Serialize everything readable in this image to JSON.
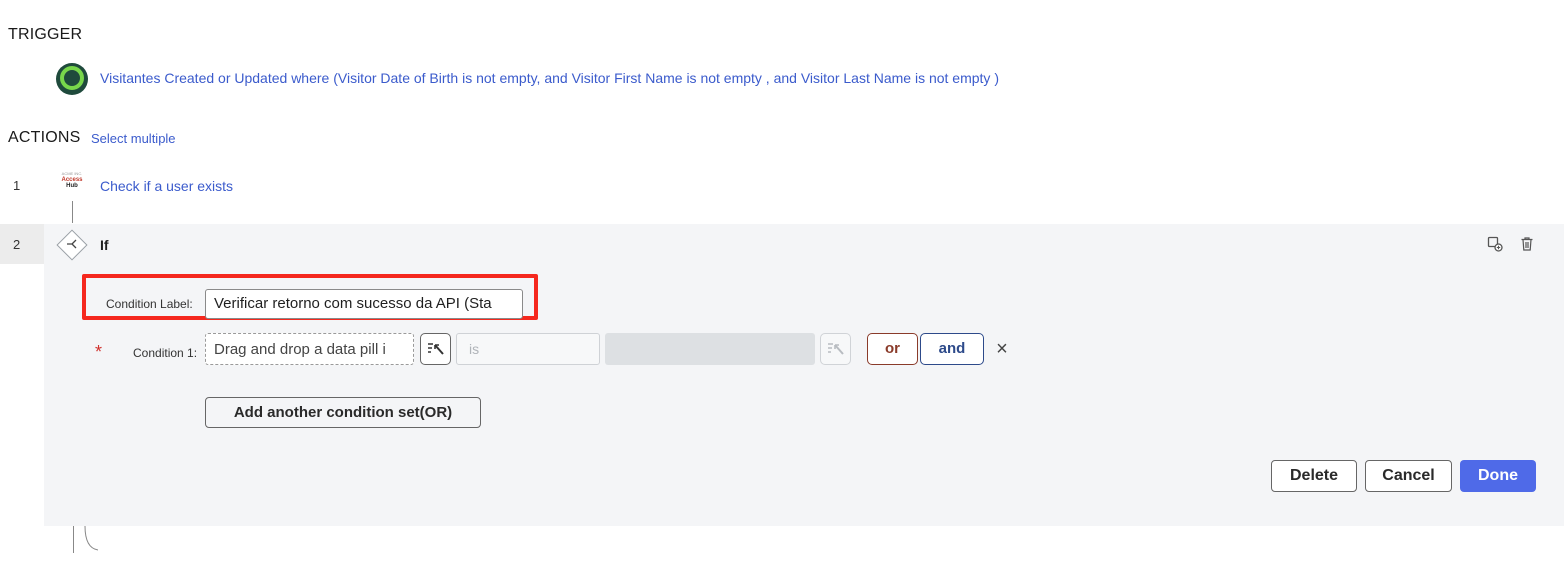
{
  "trigger": {
    "title": "TRIGGER",
    "text": "Visitantes Created or Updated where (Visitor Date of Birth is not empty, and Visitor First Name is not empty , and Visitor Last Name is not empty )"
  },
  "actions": {
    "title": "ACTIONS",
    "select_multiple": "Select multiple",
    "steps": [
      {
        "number": "1",
        "label": "Check if a user exists",
        "icon_text_top": "ACME INC.",
        "icon_text_mid": "Access",
        "icon_text_bot": "Hub"
      },
      {
        "number": "2",
        "label": "If"
      }
    ]
  },
  "if_step": {
    "condition_label_title": "Condition Label:",
    "condition_label_value": "Verificar retorno com sucesso da API (Sta",
    "required_marker": "*",
    "condition1_title": "Condition 1:",
    "data_pill_placeholder": "Drag and drop a data pill i",
    "operator_placeholder": "is",
    "or_label": "or",
    "and_label": "and",
    "remove_glyph": "×",
    "add_condition_set": "Add another condition set(OR)",
    "delete_label": "Delete",
    "cancel_label": "Cancel",
    "done_label": "Done"
  },
  "icons": {
    "trigger": "record-trigger-icon",
    "step1": "access-hub-logo-icon",
    "step2": "branch-diamond-icon",
    "pill_picker": "data-pill-picker-icon",
    "copy": "duplicate-icon",
    "trash": "trash-icon"
  },
  "colors": {
    "link": "#3b5bcc",
    "highlight": "#f5281e",
    "done": "#4f6ae8",
    "or": "#8a3b2a",
    "and": "#2d4a8a"
  }
}
